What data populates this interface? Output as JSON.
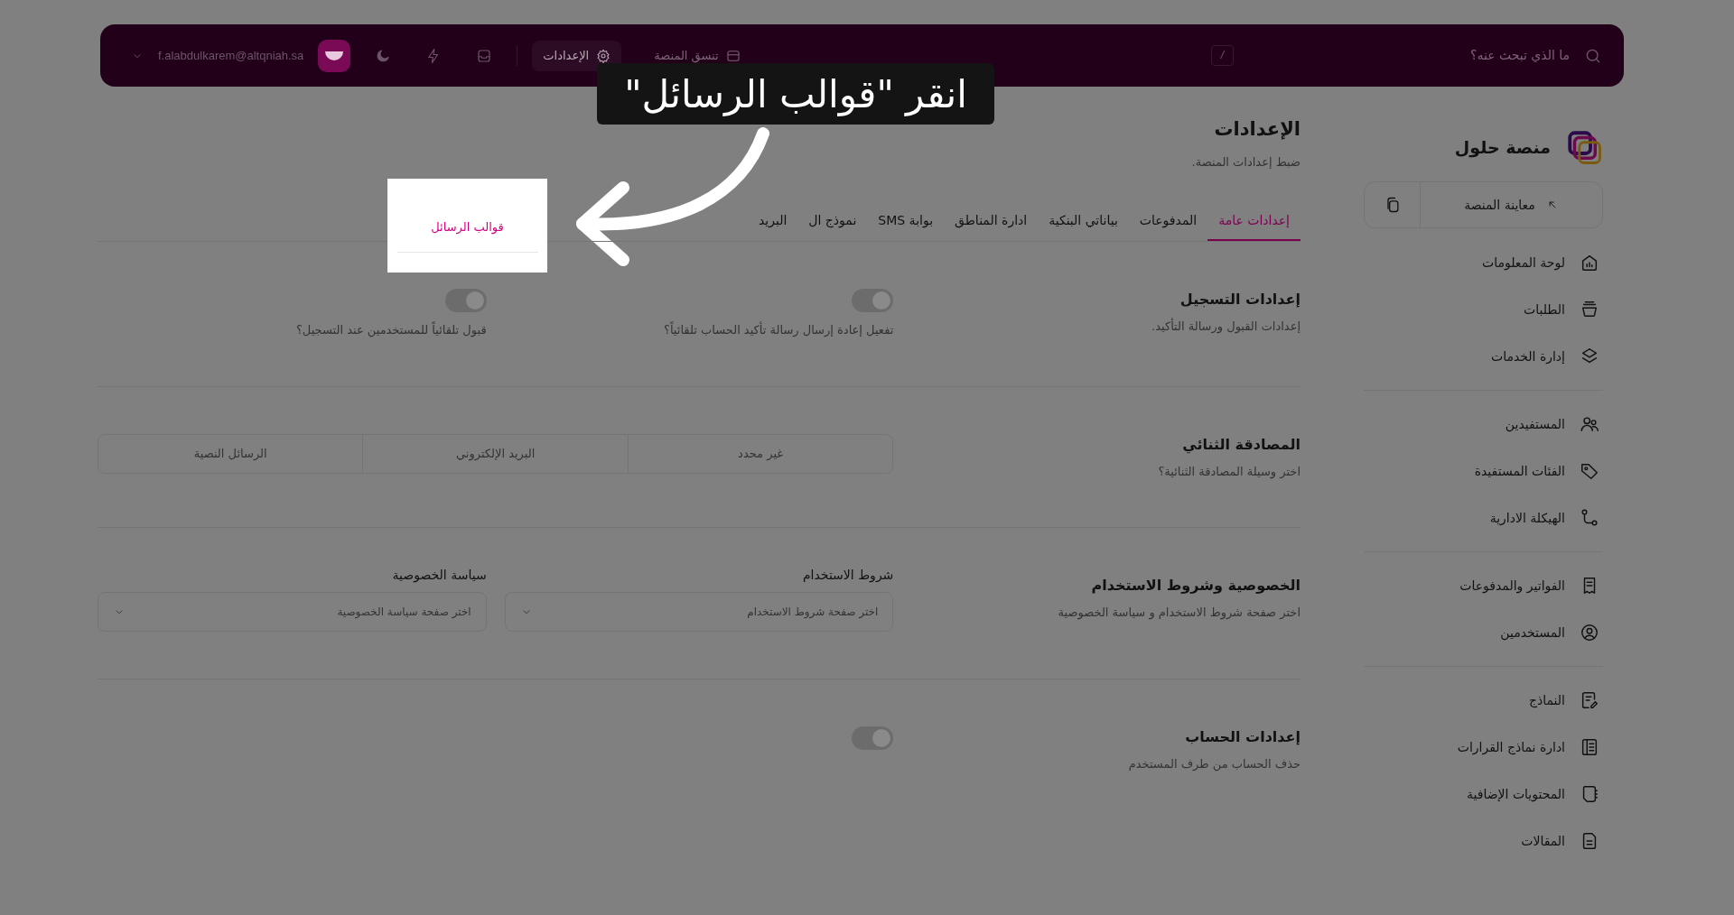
{
  "header": {
    "search_placeholder": "ما الذي تبحث عنه؟",
    "shortcut": "/",
    "links": [
      {
        "label": "تنسق المنصة",
        "selected": false
      },
      {
        "label": "الإعدادات",
        "selected": true
      }
    ],
    "user_email": "f.alabdulkarem@altqniah.sa"
  },
  "sidebar": {
    "brand": "منصة حلول",
    "preview": "معاينة المنصة",
    "groups": [
      [
        {
          "label": "لوحة المعلومات"
        },
        {
          "label": "الطلبات"
        },
        {
          "label": "إدارة الخدمات"
        }
      ],
      [
        {
          "label": "المستفيدين"
        },
        {
          "label": "الفئات المستفيدة"
        },
        {
          "label": "الهيكلة الادارية"
        }
      ],
      [
        {
          "label": "الفواتير والمدفوعات"
        },
        {
          "label": "المستخدمين"
        }
      ],
      [
        {
          "label": "النماذج"
        },
        {
          "label": "ادارة نماذج القرارات"
        },
        {
          "label": "المحتويات الإضافية"
        },
        {
          "label": "المقالات"
        }
      ]
    ]
  },
  "page": {
    "title": "الإعدادات",
    "subtitle": "ضبط إعدادات المنصة."
  },
  "tabs": [
    {
      "label": "إعدادات عامة",
      "selected": true
    },
    {
      "label": "المدفوعات",
      "selected": false
    },
    {
      "label": "بياناتي البنكية",
      "selected": false
    },
    {
      "label": "ادارة المناطق",
      "selected": false
    },
    {
      "label": "بوابة SMS",
      "selected": false
    },
    {
      "label": "نموذج ال",
      "selected": false
    },
    {
      "label": "البريد",
      "selected": false
    }
  ],
  "highlighted_tab": {
    "label": "قوالب الرسائل"
  },
  "callout": {
    "text": "انقر \"قوالب الرسائل\""
  },
  "sections": [
    {
      "kind": "toggles",
      "title": "إعدادات التسجيل",
      "description": "إعدادات القبول ورسالة التأكيد.",
      "items": [
        {
          "label": "تفعيل إعادة إرسال رسالة تأكيد الحساب تلقائياً؟",
          "on": true
        },
        {
          "label": "قبول تلقائياً للمستخدمين عند التسجيل؟",
          "on": true
        }
      ]
    },
    {
      "kind": "segments",
      "title": "المصادقة الثنائي",
      "description": "اختر وسيلة المصادقة الثنائية؟",
      "options": [
        {
          "label": "غير محدد",
          "selected": false
        },
        {
          "label": "البريد الإلكتروني",
          "selected": false
        },
        {
          "label": "الرسائل النصية",
          "selected": false
        }
      ]
    },
    {
      "kind": "selects",
      "title": "الخصوصية وشروط الاستخدام",
      "description": "اختر صفحة شروط الاستخدام و سياسة الخصوصية",
      "fields": [
        {
          "label": "شروط الاستخدام",
          "placeholder": "اختر صفحة شروط الاستخدام"
        },
        {
          "label": "سياسة الخصوصية",
          "placeholder": "اختر صفحة سياسة الخصوصية"
        }
      ]
    },
    {
      "kind": "toggles",
      "title": "إعدادات الحساب",
      "description": "حذف الحساب من طرف المستخدم",
      "items": [
        {
          "on": true
        }
      ]
    }
  ]
}
